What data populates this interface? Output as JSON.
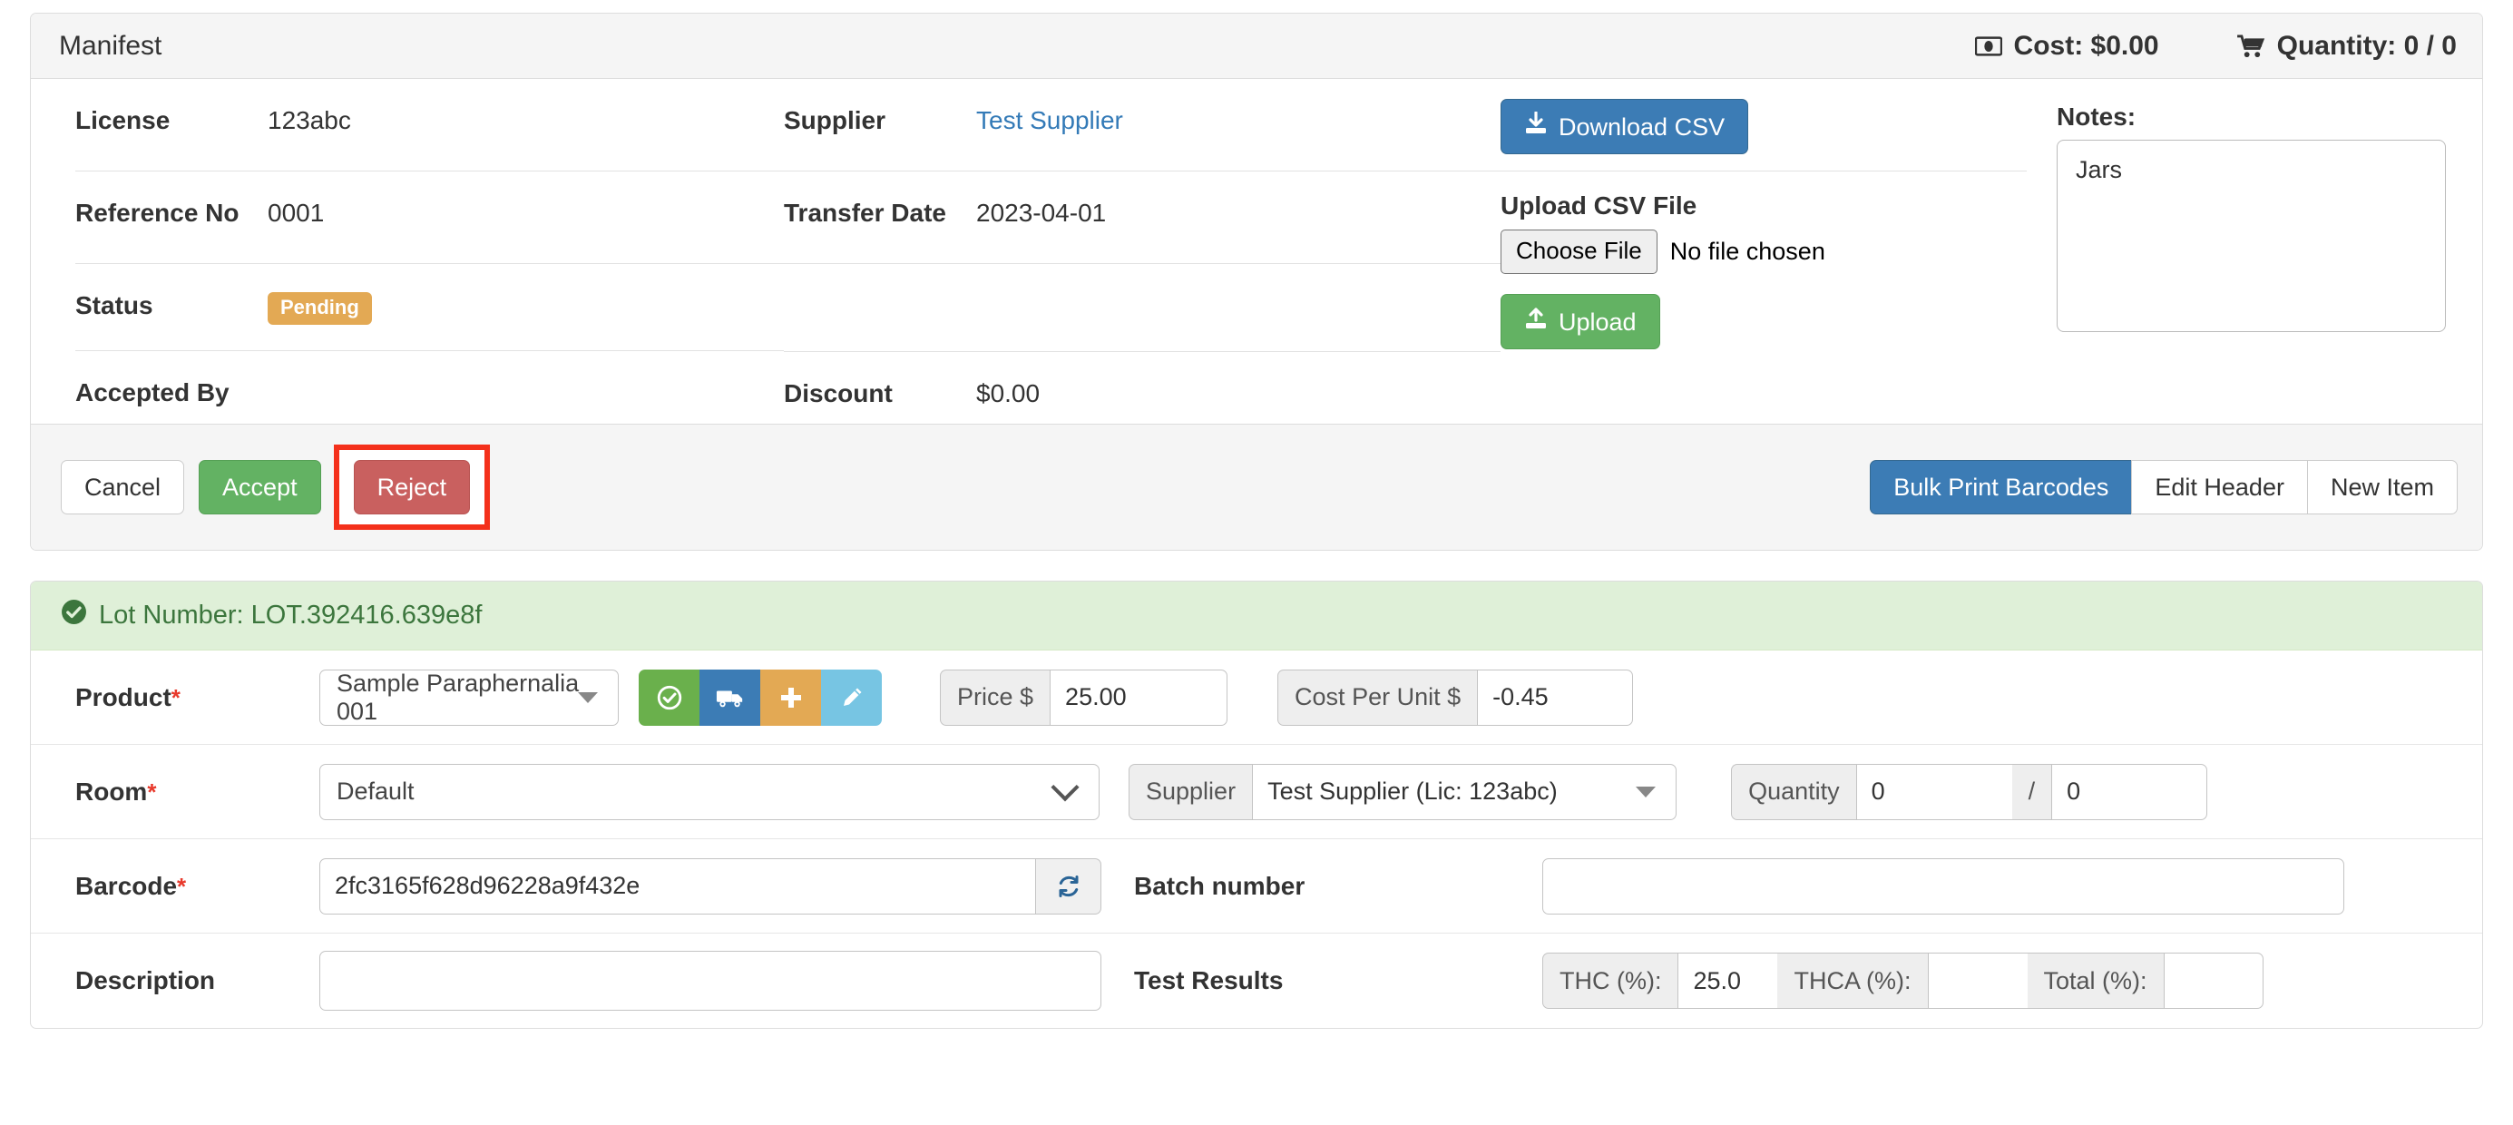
{
  "manifest": {
    "title": "Manifest",
    "cost_label": "Cost: $0.00",
    "quantity_label": "Quantity: 0 / 0",
    "fields": {
      "license_label": "License",
      "license_value": "123abc",
      "reference_label": "Reference No",
      "reference_value": "0001",
      "status_label": "Status",
      "status_value": "Pending",
      "accepted_by_label": "Accepted By",
      "accepted_by_value": "",
      "supplier_label": "Supplier",
      "supplier_value": "Test Supplier",
      "transfer_date_label": "Transfer Date",
      "transfer_date_value": "2023-04-01",
      "discount_label": "Discount",
      "discount_value": "$0.00"
    },
    "csv": {
      "download_label": "Download CSV",
      "upload_section_label": "Upload CSV File",
      "choose_file_label": "Choose File",
      "no_file_label": "No file chosen",
      "upload_label": "Upload"
    },
    "notes": {
      "label": "Notes:",
      "value": "Jars"
    },
    "actions": {
      "cancel": "Cancel",
      "accept": "Accept",
      "reject": "Reject",
      "bulk_print": "Bulk Print Barcodes",
      "edit_header": "Edit Header",
      "new_item": "New Item"
    }
  },
  "lot": {
    "header": "Lot Number: LOT.392416.639e8f",
    "product": {
      "label": "Product",
      "required_mark": "*",
      "value": "Sample Paraphernalia 001"
    },
    "price": {
      "addon": "Price $",
      "value": "25.00"
    },
    "cost_per_unit": {
      "addon": "Cost Per Unit $",
      "value": "-0.45"
    },
    "room": {
      "label": "Room",
      "required_mark": "*",
      "value": "Default"
    },
    "supplier": {
      "addon": "Supplier",
      "value": "Test Supplier (Lic: 123abc)"
    },
    "quantity": {
      "addon": "Quantity",
      "value_a": "0",
      "separator": "/",
      "value_b": "0"
    },
    "barcode": {
      "label": "Barcode",
      "required_mark": "*",
      "value": "2fc3165f628d96228a9f432e"
    },
    "batch_number": {
      "label": "Batch number",
      "value": ""
    },
    "description": {
      "label": "Description",
      "value": ""
    },
    "test_results": {
      "label": "Test Results",
      "thc_label": "THC (%):",
      "thc_value": "25.0",
      "thca_label": "THCA (%):",
      "thca_value": "",
      "total_label": "Total (%):",
      "total_value": ""
    }
  },
  "colors": {
    "primary_blue": "#3c7cb5",
    "success_green": "#63b263",
    "danger_red": "#c9605f",
    "pending_orange": "#e3a954",
    "highlight_red": "#f4301b",
    "lot_green_bg": "#dff0d8",
    "lot_green_text": "#3c763d",
    "icon_green": "#6ab04c",
    "icon_blue": "#3c7cb5",
    "icon_orange": "#e3a954",
    "icon_lightblue": "#77c5e3"
  }
}
